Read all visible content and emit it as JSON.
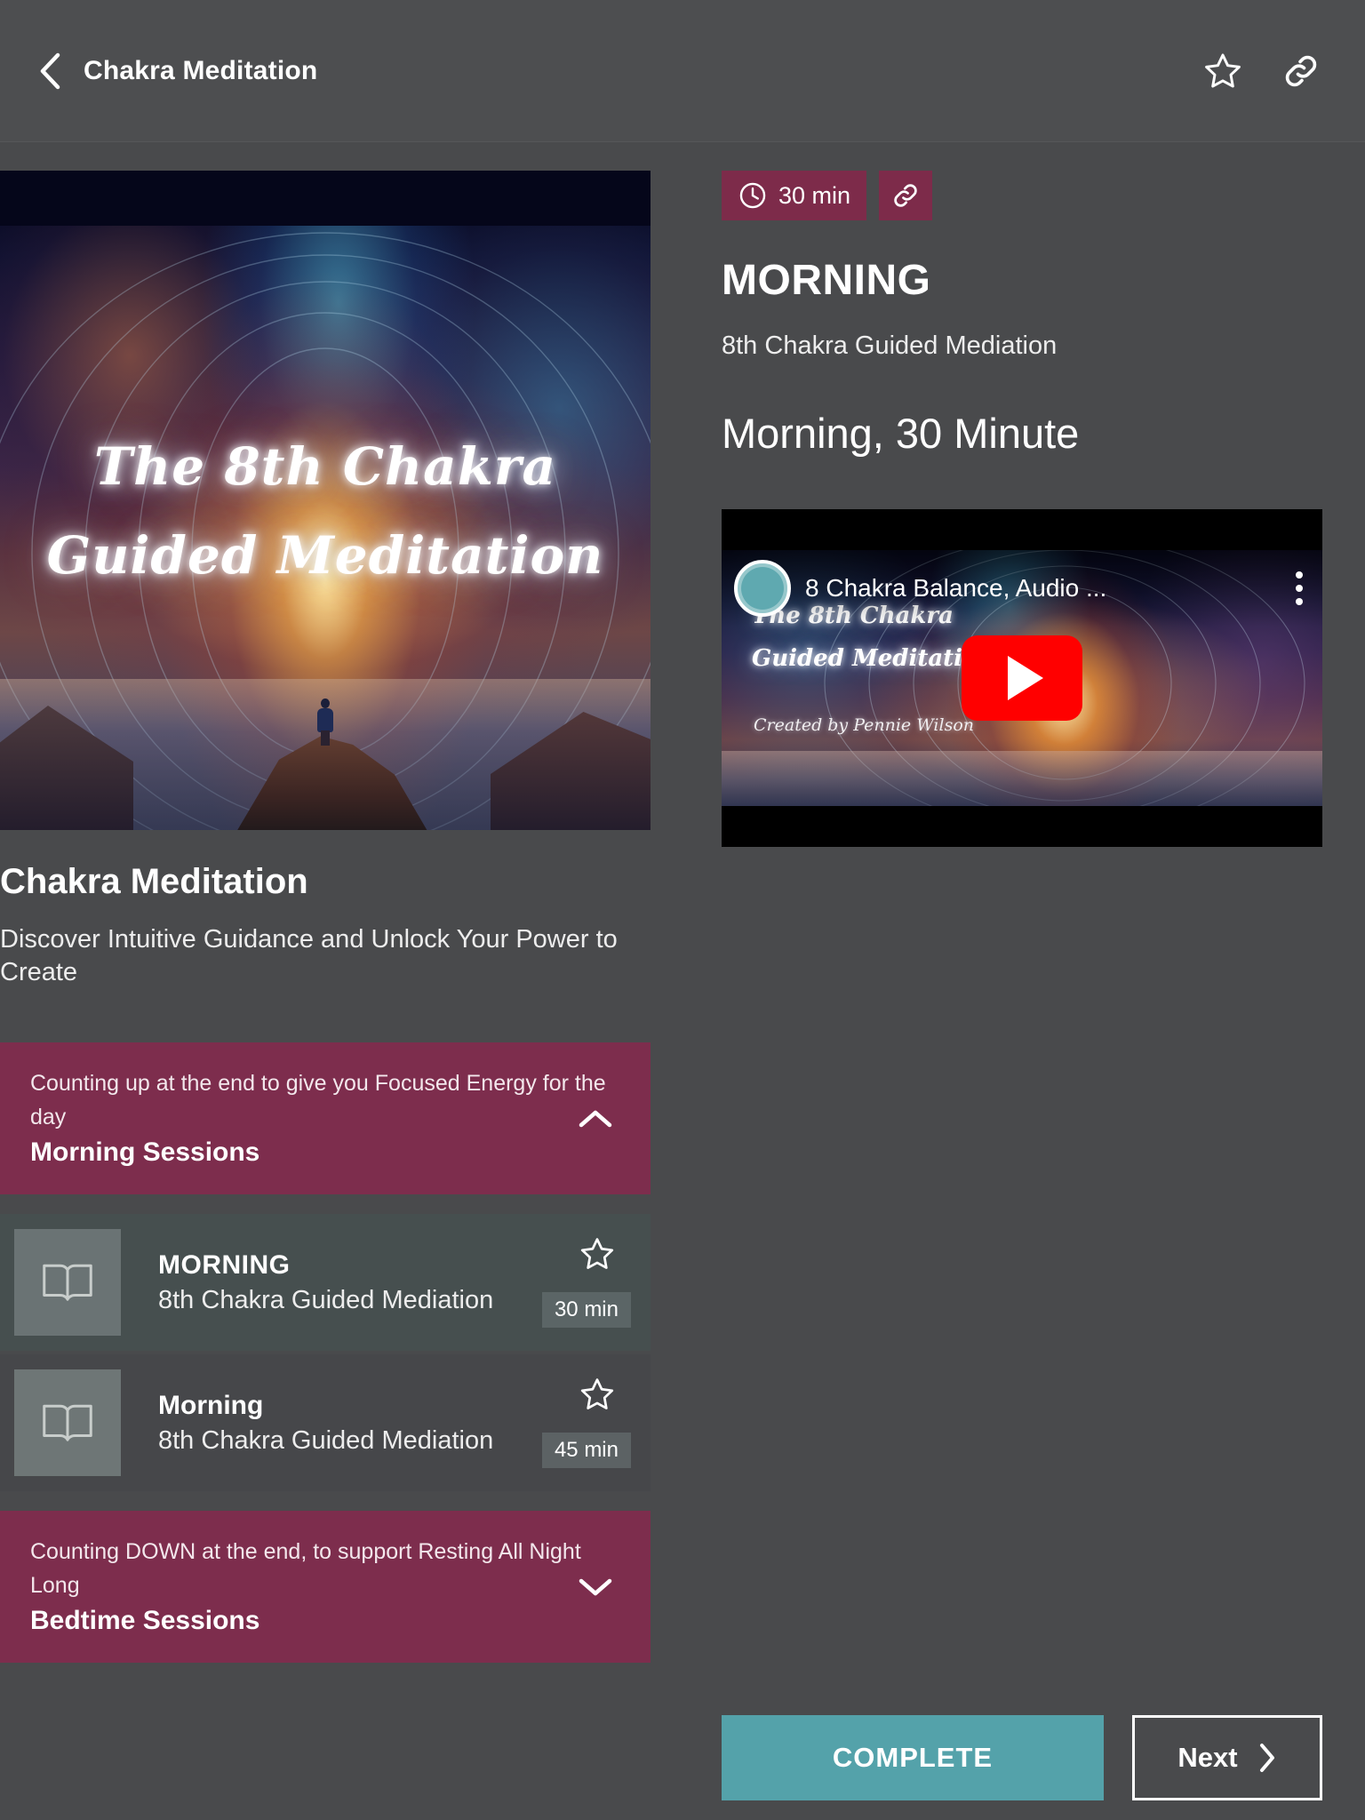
{
  "appbar": {
    "title": "Chakra Meditation",
    "back_icon": "chevron-left-icon",
    "favorite_icon": "star-outline-icon",
    "share_icon": "link-icon"
  },
  "colors": {
    "background": "#494A4C",
    "appbar": "#4D4E50",
    "accent_magenta": "#7D2D4D",
    "accent_teal": "#54A2AA",
    "row": "#46474A",
    "row_selected": "#464F4F",
    "duration_chip": "#5C6264"
  },
  "left": {
    "hero": {
      "overlay_text": "The 8th Chakra\nGuided Meditation"
    },
    "course_title": "Chakra Meditation",
    "course_description": "Discover Intuitive Guidance and Unlock Your Power to Create",
    "sections": [
      {
        "subtitle": "Counting up at the end to give you Focused Energy for the day",
        "title": "Morning Sessions",
        "chevron": "chevron-up-icon",
        "expanded": true
      },
      {
        "subtitle": "Counting DOWN at the end,  to support  Resting All Night Long",
        "title": "Bedtime Sessions",
        "chevron": "chevron-down-icon",
        "expanded": false
      }
    ],
    "sessions": [
      {
        "title": "MORNING",
        "subtitle": "8th Chakra Guided Mediation",
        "duration": "30 min",
        "thumb_icon": "book-icon",
        "star_icon": "star-outline-icon",
        "selected": true
      },
      {
        "title": "Morning",
        "subtitle": "8th Chakra Guided Mediation",
        "duration": "45 min",
        "thumb_icon": "book-icon",
        "star_icon": "star-outline-icon",
        "selected": false
      }
    ]
  },
  "right": {
    "duration_badge": "30 min",
    "clock_icon": "clock-icon",
    "link_icon": "link-icon",
    "headline": "MORNING",
    "description": "8th Chakra Guided Mediation",
    "subheading": "Morning, 30 Minute",
    "video": {
      "channel_title": "8 Chakra Balance, Audio ...",
      "overlay_text": "The  8th Chakra\nGuided Meditation",
      "credit": "Created by Pennie Wilson",
      "play_icon": "youtube-play-icon",
      "kebab_icon": "more-vertical-icon",
      "avatar_icon": "channel-avatar-icon"
    }
  },
  "footer": {
    "complete_label": "COMPLETE",
    "next_label": "Next",
    "next_icon": "chevron-right-icon"
  }
}
